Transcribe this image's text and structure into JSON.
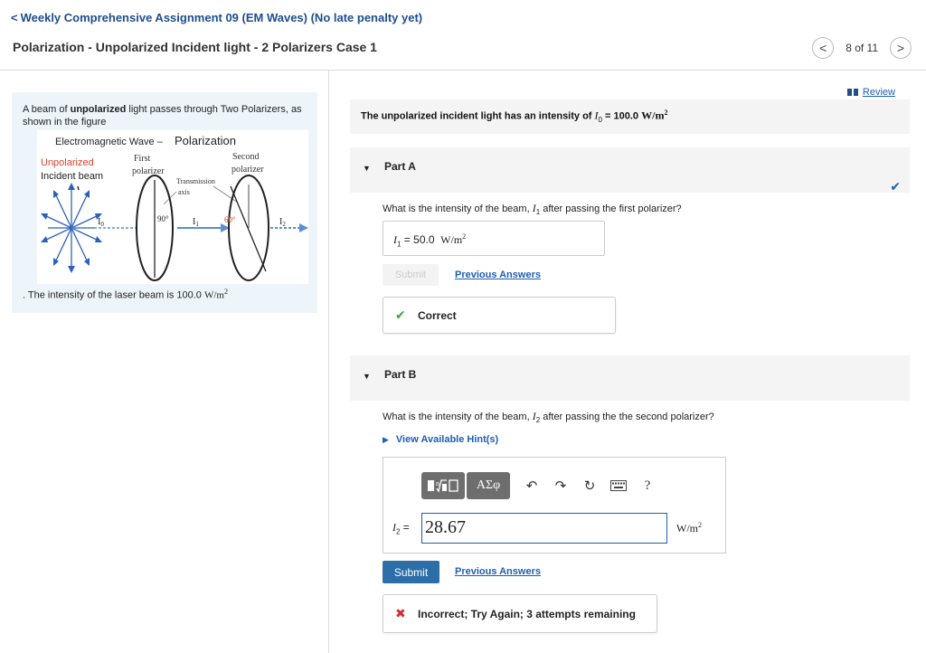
{
  "header": {
    "back_chevron": "<",
    "back_label": "Weekly Comprehensive Assignment 09 (EM Waves) (No late penalty yet)",
    "title": "Polarization - Unpolarized Incident light - 2 Polarizers Case 1",
    "pager": {
      "prev_icon": "<",
      "count": "8 of 11",
      "next_icon": ">"
    }
  },
  "intro": {
    "text_prefix": "A beam of ",
    "text_bold": "unpolarized",
    "text_suffix": " light passes through Two Polarizers, as shown in the figure",
    "intensity_note_prefix": ". The intensity of the laser beam is 100.0 ",
    "intensity_note_unit": "W/m",
    "intensity_note_exp": "2"
  },
  "figure": {
    "title_small": "Electromagnetic Wave – ",
    "title_big": "Polarization",
    "unpolarized": "Unpolarized",
    "incident_beam": "Incident beam",
    "first_polarizer_1": "First",
    "first_polarizer_2": "polarizer",
    "second_polarizer_1": "Second",
    "second_polarizer_2": "polarizer",
    "transmission_1": "Transmission",
    "transmission_2": "axis",
    "angle1": "90°",
    "angle2": "60°",
    "i0": "I",
    "i0_sub": "0",
    "i1": "I",
    "i1_sub": "1",
    "i2": "I",
    "i2_sub": "2"
  },
  "review": {
    "label": "Review"
  },
  "given": {
    "prefix": "The unpolarized incident light has an intensity of ",
    "symbol": "I",
    "symbol_sub": "0",
    "eq": " = 100.0 ",
    "unit": "W/m",
    "unit_exp": "2"
  },
  "partA": {
    "label": "Part A",
    "question_prefix": "What is the intensity of the beam, ",
    "question_symbol": "I",
    "question_sub": "1",
    "question_suffix": " after passing the first polarizer?",
    "answer_symbol": "I",
    "answer_sub": "1",
    "answer_eq": " = ",
    "answer_value": "50.0",
    "answer_unit": "W/m",
    "answer_unit_exp": "2",
    "submit_label": "Submit",
    "previous_answers_label": "Previous Answers",
    "feedback": "Correct"
  },
  "partB": {
    "label": "Part B",
    "question_prefix": "What is the intensity of the beam, ",
    "question_symbol": "I",
    "question_sub": "2",
    "question_suffix": " after passing the the second polarizer?",
    "hint_label": "View Available Hint(s)",
    "toolbar": {
      "greek": "AΣφ",
      "help": "?"
    },
    "eq_symbol": "I",
    "eq_sub": "2",
    "eq_equals": " =",
    "input_value": "28.67",
    "unit": "W/m",
    "unit_exp": "2",
    "submit_label": "Submit",
    "previous_answers_label": "Previous Answers",
    "feedback": "Incorrect; Try Again; 3 attempts remaining"
  },
  "colors": {
    "link": "#1d5fb4",
    "correct": "#3aa53a",
    "incorrect": "#d0312d",
    "submit": "#2c6ea8"
  }
}
